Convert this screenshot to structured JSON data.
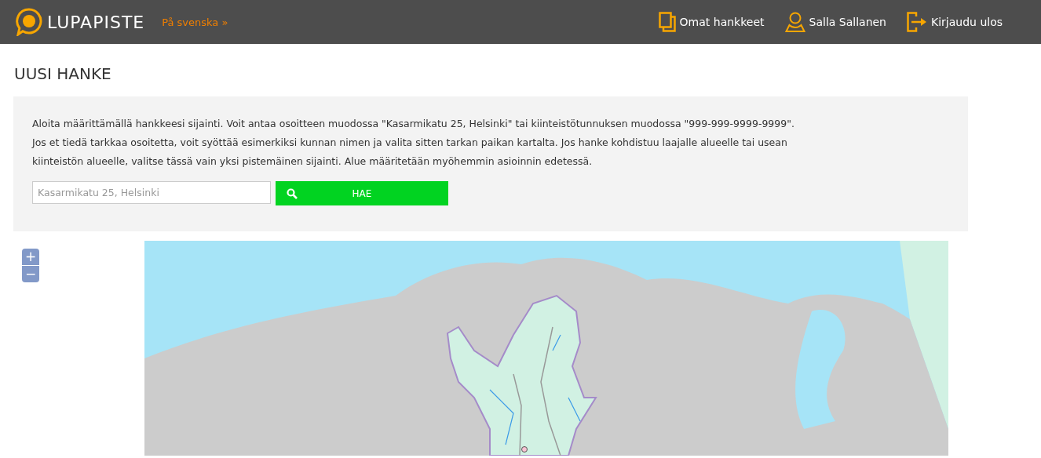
{
  "header": {
    "logo": "LUPAPISTE",
    "language_link": "På svenska »",
    "nav": [
      {
        "kind": "projects",
        "label": "Omat hankkeet"
      },
      {
        "kind": "user",
        "label": "Salla Sallanen"
      },
      {
        "kind": "logout",
        "label": "Kirjaudu ulos"
      }
    ]
  },
  "page_title": "UUSI HANKE",
  "intro": [
    "Aloita määrittämällä hankkeesi sijainti. Voit antaa osoitteen muodossa \"Kasarmikatu 25, Helsinki\" tai kiinteistötunnuksen muodossa \"999-999-9999-9999\".",
    "Jos et tiedä tarkkaa osoitetta, voit syöttää esimerkiksi kunnan nimen ja valita sitten tarkan paikan kartalta. Jos hanke kohdistuu laajalle alueelle tai usean kiinteistön alueelle, valitse tässä vain yksi pistemäinen sijainti. Alue määritetään myöhemmin asioinnin edetessä."
  ],
  "search": {
    "placeholder": "Kasarmikatu 25, Helsinki",
    "button": "HAE"
  },
  "map": {
    "zoom_in": "+",
    "zoom_out": "−"
  }
}
